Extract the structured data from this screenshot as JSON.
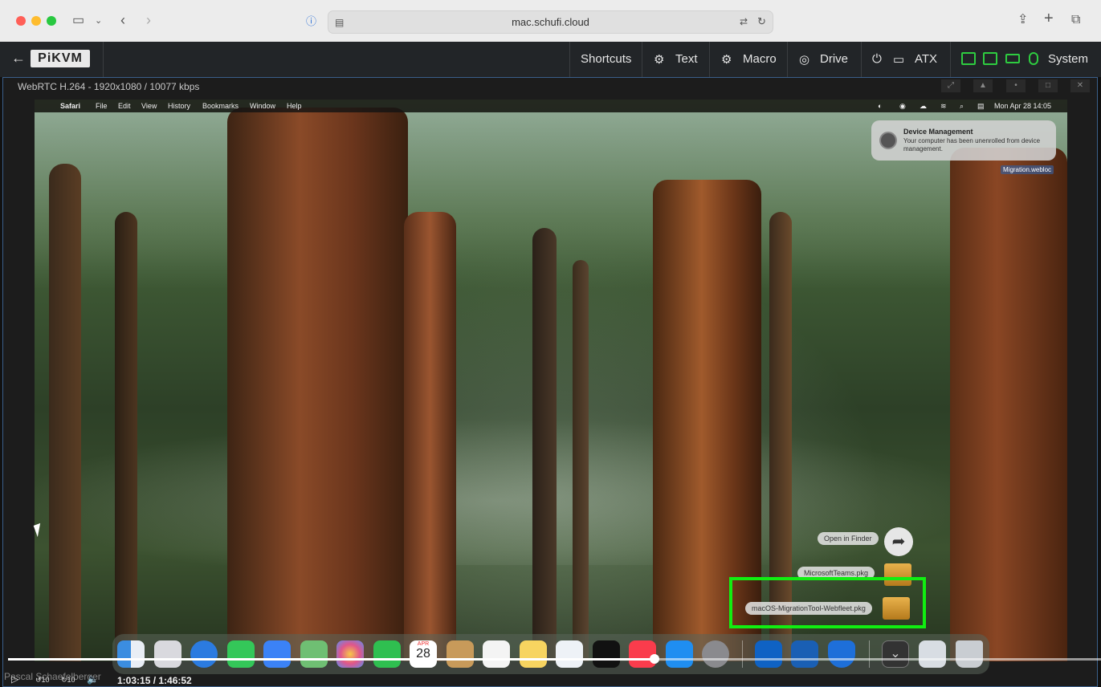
{
  "browser": {
    "url": "mac.schufi.cloud"
  },
  "kvm": {
    "logo": "PiKVM",
    "menu": {
      "shortcuts": "Shortcuts",
      "text": "Text",
      "macro": "Macro",
      "drive": "Drive",
      "atx": "ATX",
      "system": "System"
    }
  },
  "stream": {
    "title": "WebRTC H.264 - 1920x1080 / 10077 kbps"
  },
  "mac_menubar": {
    "items": [
      "Safari",
      "File",
      "Edit",
      "View",
      "History",
      "Bookmarks",
      "Window",
      "Help"
    ],
    "datetime": "Mon Apr 28  14:05"
  },
  "notification": {
    "title": "Device Management",
    "body": "Your computer has been unenrolled from device management."
  },
  "desktop_file": {
    "label": "Migration.webloc"
  },
  "stack": {
    "open_in_finder": "Open in Finder",
    "item1": "MicrosoftTeams.pkg",
    "item2": "macOS-MigrationTool-Webfleet.pkg"
  },
  "dock": {
    "calendar_month": "APR",
    "calendar_day": "28"
  },
  "player": {
    "time": "1:03:15 / 1:46:52",
    "progress": 0.5917,
    "skip_back": "10",
    "skip_fwd": "10",
    "watermark": "Pascal Schaefelberger"
  },
  "colors": {
    "highlight": "#11ee11",
    "kvm_active": "#2ecc40"
  }
}
